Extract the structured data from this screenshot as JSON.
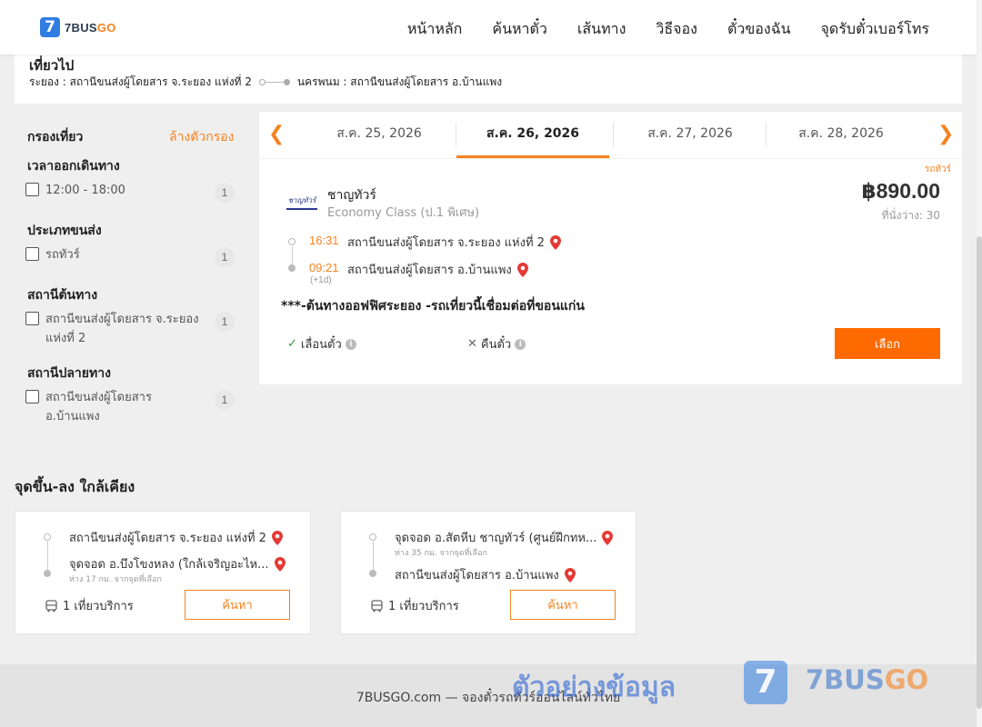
{
  "brand": {
    "logo_letter": "7",
    "name_main": "7BUS",
    "name_accent": "GO"
  },
  "nav": {
    "items": [
      "หน้าหลัก",
      "ค้นหาตั๋ว",
      "เส้นทาง",
      "วิธีจอง",
      "ตั๋วของฉัน",
      "จุดรับตั๋วเบอร์โทร"
    ]
  },
  "trip": {
    "title": "เที่ยวไป",
    "origin": "ระยอง : สถานีขนส่งผู้โดยสาร จ.ระยอง แห่งที่ 2",
    "destination": "นครพนม : สถานีขนส่งผู้โดยสาร อ.บ้านแพง"
  },
  "filters": {
    "title": "กรองเที่ยว",
    "clear": "ล้างตัวกรอง",
    "sections": [
      {
        "title": "เวลาออกเดินทาง",
        "options": [
          {
            "label": "12:00 - 18:00",
            "count": "1"
          }
        ]
      },
      {
        "title": "ประเภทขนส่ง",
        "options": [
          {
            "label": "รถทัวร์",
            "count": "1"
          }
        ]
      },
      {
        "title": "สถานีต้นทาง",
        "options": [
          {
            "label": "สถานีขนส่งผู้โดยสาร จ.ระยอง แห่งที่ 2",
            "count": "1"
          }
        ]
      },
      {
        "title": "สถานีปลายทาง",
        "options": [
          {
            "label": "สถานีขนส่งผู้โดยสาร อ.บ้านแพง",
            "count": "1"
          }
        ]
      }
    ]
  },
  "dates": {
    "tabs": [
      "ส.ค. 25, 2026",
      "ส.ค. 26, 2026",
      "ส.ค. 27, 2026",
      "ส.ค. 28, 2026"
    ],
    "active_index": 1,
    "prev_icon": "chevron-left-icon",
    "next_icon": "chevron-right-icon"
  },
  "result": {
    "tag": "รถทัวร์",
    "operator_logo_text": "ชาญทัวร์",
    "operator": "ชาญทัวร์",
    "class": "Economy Class (ป.1 พิเศษ)",
    "price": "฿890.00",
    "seats": "ที่นั่งว่าง: 30",
    "depart_time": "16:31",
    "depart_station": "สถานีขนส่งผู้โดยสาร จ.ระยอง แห่งที่ 2",
    "arrive_time": "09:21",
    "arrive_station": "สถานีขนส่งผู้โดยสาร อ.บ้านแพง",
    "plus_day": "(+1d)",
    "note": "***-ต้นทางออฟฟิศระยอง -รถเที่ยวนี้เชื่อมต่อที่ขอนแก่น",
    "reschedule": "เลื่อนตั๋ว",
    "refund": "คืนตั๋ว",
    "select_label": "เลือก"
  },
  "nearby": {
    "title": "จุดขึ้น-ลง ใกล้เคียง",
    "cards": [
      {
        "from": "สถานีขนส่งผู้โดยสาร จ.ระยอง แห่งที่ 2",
        "from_dist": "",
        "to": "จุดจอด อ.บึงโขงหลง (ใกล้เจริญอะไห...",
        "to_dist": "ห่าง 17 กม. จากจุดที่เลือก",
        "trips": "1 เที่ยวบริการ",
        "search_label": "ค้นหา"
      },
      {
        "from": "จุดจอด อ.สัตหีบ ชาญทัวร์ (ศูนย์ฝึกทห...",
        "from_dist": "ห่าง 35 กม. จากจุดที่เลือก",
        "to": "สถานีขนส่งผู้โดยสาร อ.บ้านแพง",
        "to_dist": "",
        "trips": "1 เที่ยวบริการ",
        "search_label": "ค้นหา"
      }
    ]
  },
  "footer": {
    "text": "7BUSGO.com — จองตั๋วรถทัวร์ออนไลน์ทั่วไทย"
  },
  "watermark": {
    "text": "ตัวอย่างข้อมูล",
    "logo_letter": "7",
    "brand_main": "7BUS",
    "brand_accent": "GO"
  },
  "colors": {
    "accent": "#f5821f",
    "button": "#ff6a00",
    "brand_blue": "#2f7de1",
    "pin": "#e53935"
  }
}
